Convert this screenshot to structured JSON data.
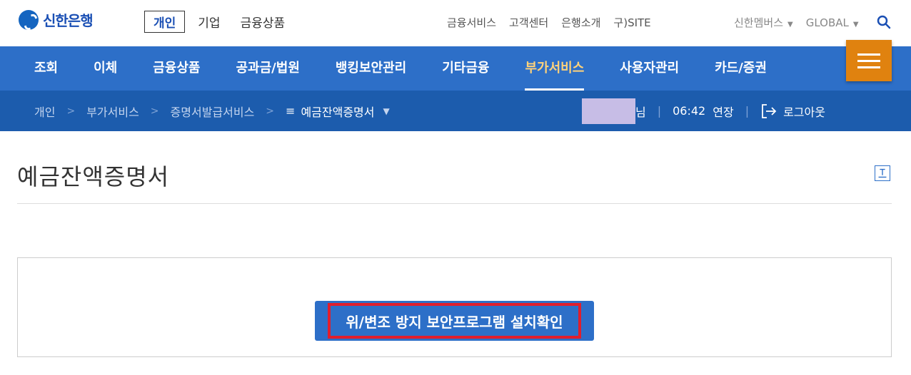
{
  "brand": {
    "name": "신한은행",
    "color": "#1a4fb4"
  },
  "segment_nav": [
    {
      "label": "개인",
      "active": true
    },
    {
      "label": "기업",
      "active": false
    },
    {
      "label": "금융상품",
      "active": false
    }
  ],
  "util_nav": [
    "금융서비스",
    "고객센터",
    "은행소개",
    "구)SITE"
  ],
  "member_nav": {
    "member": "신한멤버스",
    "global": "GLOBAL"
  },
  "icons": {
    "search": "search-icon",
    "menu": "hamburger-menu-icon",
    "logout": "logout-icon",
    "print": "print-icon"
  },
  "main_nav": [
    {
      "label": "조회"
    },
    {
      "label": "이체"
    },
    {
      "label": "금융상품"
    },
    {
      "label": "공과금/법원"
    },
    {
      "label": "뱅킹보안관리"
    },
    {
      "label": "기타금융"
    },
    {
      "label": "부가서비스",
      "active": true
    },
    {
      "label": "사용자관리"
    },
    {
      "label": "카드/증권"
    }
  ],
  "breadcrumb": [
    "개인",
    "부가서비스",
    "증명서발급서비스",
    "예금잔액증명서"
  ],
  "session": {
    "suffix": "님",
    "time": "06:42",
    "extend": "연장",
    "logout": "로그아웃"
  },
  "page": {
    "title": "예금잔액증명서"
  },
  "action": {
    "label": "위/변조 방지 보안프로그램 설치확인"
  },
  "colors": {
    "nav": "#2d6fc8",
    "subnav": "#1c5cad",
    "menu_button": "#e0820f",
    "highlight": "#e01e2d"
  }
}
